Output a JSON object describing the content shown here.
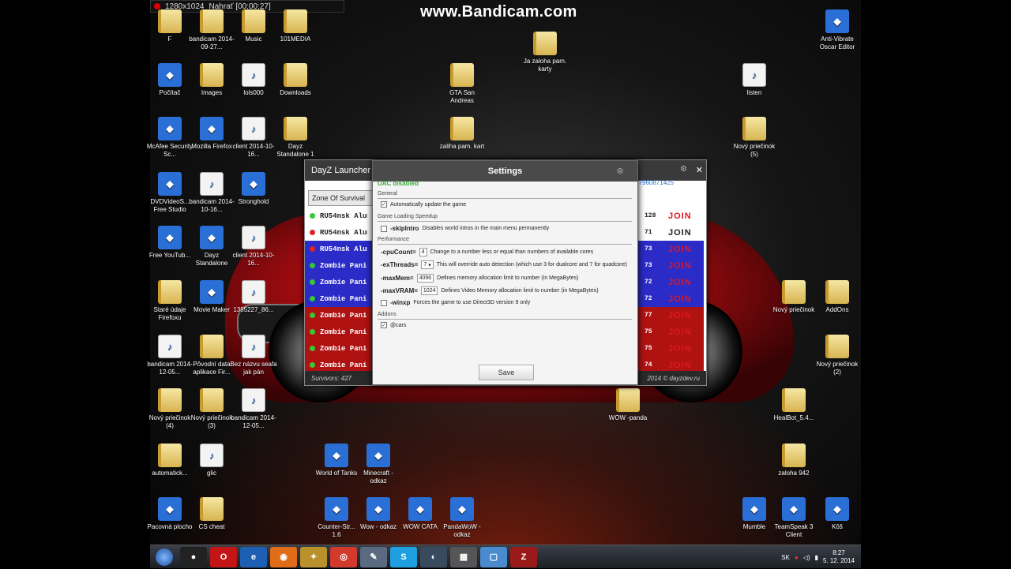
{
  "recorder": {
    "resolution": "1280x1024",
    "status": "Nahrať [00:00:27]"
  },
  "watermark": "www.Bandicam.com",
  "desktop_icons": [
    {
      "label": "F",
      "type": "folder"
    },
    {
      "label": "bandicam 2014-09-27...",
      "type": "folder"
    },
    {
      "label": "Music",
      "type": "folder"
    },
    {
      "label": "101MEDIA",
      "type": "folder"
    },
    {
      "label": "Ja zaloha pam. karty",
      "type": "folder"
    },
    {
      "label": "Anti-Vibrate Oscar Editor",
      "type": "app"
    },
    {
      "label": "Počítač",
      "type": "app"
    },
    {
      "label": "Images",
      "type": "folder"
    },
    {
      "label": "lols000",
      "type": "file"
    },
    {
      "label": "Downloads",
      "type": "folder"
    },
    {
      "label": "GTA San Andreas",
      "type": "folder"
    },
    {
      "label": "listen",
      "type": "file"
    },
    {
      "label": "McAfee Security Sc...",
      "type": "app"
    },
    {
      "label": "Mozilla Firefox",
      "type": "app"
    },
    {
      "label": "client 2014-10-16...",
      "type": "file"
    },
    {
      "label": "Dayz Standalone 1",
      "type": "folder"
    },
    {
      "label": "zaliha pam. kart",
      "type": "folder"
    },
    {
      "label": "Nový priečinok (5)",
      "type": "folder"
    },
    {
      "label": "DVDVideoS... Free Studio",
      "type": "app"
    },
    {
      "label": "bandicam 2014-10-16...",
      "type": "file"
    },
    {
      "label": "Stronghold",
      "type": "app"
    },
    {
      "label": "Free YouTub...",
      "type": "app"
    },
    {
      "label": "Dayz Standalone",
      "type": "app"
    },
    {
      "label": "client 2014-10-16...",
      "type": "file"
    },
    {
      "label": "Staré údaje Firefoxu",
      "type": "folder"
    },
    {
      "label": "Movie Maker",
      "type": "app"
    },
    {
      "label": "1385227_86...",
      "type": "file"
    },
    {
      "label": "Nový priečinok",
      "type": "folder"
    },
    {
      "label": "AddOns",
      "type": "folder"
    },
    {
      "label": "bandicam 2014-12-05...",
      "type": "file"
    },
    {
      "label": "Pôvodní data aplikace Fir...",
      "type": "folder"
    },
    {
      "label": "Bez názvu seafa jak pán",
      "type": "file"
    },
    {
      "label": "Nový priečinok (2)",
      "type": "folder"
    },
    {
      "label": "Nový priečinok (4)",
      "type": "folder"
    },
    {
      "label": "Nový priečinok (3)",
      "type": "folder"
    },
    {
      "label": "bandicam 2014-12-05...",
      "type": "file"
    },
    {
      "label": "WOW -panda",
      "type": "folder"
    },
    {
      "label": "HealBot_5.4...",
      "type": "folder"
    },
    {
      "label": "automatick...",
      "type": "folder"
    },
    {
      "label": "glic",
      "type": "file"
    },
    {
      "label": "World of Tanks",
      "type": "app"
    },
    {
      "label": "Minecraft - odkaz",
      "type": "app"
    },
    {
      "label": "zaloha 942",
      "type": "folder"
    },
    {
      "label": "Pacovná plocho",
      "type": "app"
    },
    {
      "label": "CS cheat",
      "type": "folder"
    },
    {
      "label": "Counter-Str... 1.6",
      "type": "app"
    },
    {
      "label": "Wow - odkaz",
      "type": "app"
    },
    {
      "label": "WOW CATA",
      "type": "app"
    },
    {
      "label": "PandaWoW - odkaz",
      "type": "app"
    },
    {
      "label": "Mumble",
      "type": "app"
    },
    {
      "label": "TeamSpeak 3 Client",
      "type": "app"
    },
    {
      "label": "Kôš",
      "type": "app"
    }
  ],
  "launcher": {
    "title": "DayZ Launcher",
    "tab": "Zone Of Survival",
    "steam_id": "76561197960871425",
    "servers": [
      {
        "name": "RU54nsk Alum",
        "ping": "128",
        "join": "JOIN",
        "status": "ok",
        "row": "white"
      },
      {
        "name": "RU54nsk Alum",
        "ping": "71",
        "join": "JOIN",
        "status": "bad",
        "row": "white"
      },
      {
        "name": "RU54nsk Alum",
        "ping": "73",
        "join": "JOIN",
        "status": "bad",
        "row": "blue"
      },
      {
        "name": "Zombie Panic",
        "ping": "73",
        "join": "JOIN",
        "status": "ok",
        "row": "blue"
      },
      {
        "name": "Zombie Panic",
        "ping": "72",
        "join": "JOIN",
        "status": "ok",
        "row": "blue"
      },
      {
        "name": "Zombie Panic",
        "ping": "72",
        "join": "JOIN",
        "status": "ok",
        "row": "blue"
      },
      {
        "name": "Zombie Panic",
        "ping": "77",
        "join": "JOIN",
        "status": "ok",
        "row": "red"
      },
      {
        "name": "Zombie Panic",
        "ping": "75",
        "join": "JOIN",
        "status": "ok",
        "row": "red"
      },
      {
        "name": "Zombie Panic",
        "ping": "75",
        "join": "JOIN",
        "status": "ok",
        "row": "red"
      },
      {
        "name": "Zombie Panic",
        "ping": "74",
        "join": "JOIN",
        "status": "ok",
        "row": "red"
      }
    ],
    "footer_left": "Survivors: 427",
    "footer_right": "2014 © dayzdev.ru"
  },
  "settings": {
    "title": "Settings",
    "uac": "UAC disabled",
    "general_label": "General",
    "auto_update": "Automatically update the game",
    "speedup_label": "Game Loading Speedup",
    "skipintro": "-skipIntro",
    "skipintro_desc": "Disables world intros in the main menu permanently",
    "performance_label": "Performance",
    "cpucount": "-cpuCount=",
    "cpucount_val": "4",
    "cpucount_desc": "Change to a number less or equal than numbers of available cores",
    "exthreads": "-exThreads=",
    "exthreads_val": "7",
    "exthreads_desc": "This will override auto detection (which use 3 for dualcore and 7 for quadcore)",
    "maxmem": "-maxMem=",
    "maxmem_val": "4096",
    "maxmem_desc": "Defines memory allocation limit to number (in MegaBytes)",
    "maxvram": "-maxVRAM=",
    "maxvram_val": "1024",
    "maxvram_desc": "Defines Video Memory allocation limit to number (in MegaBytes)",
    "winxp": "-winxp",
    "winxp_desc": "Forces the game to use Direct3D version 9 only",
    "addons_label": "Addons",
    "cars": "@cars",
    "save": "Save"
  },
  "taskbar": {
    "lang": "SK",
    "time": "8:27",
    "date": "5. 12. 2014"
  },
  "colors": {
    "join_red": "#e0171f",
    "uac_green": "#3fa83f",
    "row_blue": "#2b2bc8",
    "row_red": "#b01212"
  }
}
